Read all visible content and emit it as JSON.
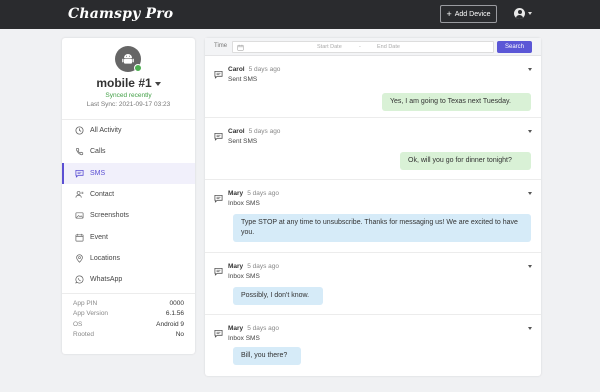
{
  "app": {
    "logo": "Chamspy Pro"
  },
  "topbar": {
    "add_device_label": "Add Device"
  },
  "device": {
    "name": "mobile #1",
    "sync_status": "Synced recently",
    "last_sync": "Last Sync: 2021-09-17 03:23"
  },
  "nav": {
    "items": [
      {
        "label": "All Activity",
        "icon": "clock-icon"
      },
      {
        "label": "Calls",
        "icon": "phone-icon"
      },
      {
        "label": "SMS",
        "icon": "message-icon",
        "active": true
      },
      {
        "label": "Contact",
        "icon": "contacts-icon"
      },
      {
        "label": "Screenshots",
        "icon": "image-icon"
      },
      {
        "label": "Event",
        "icon": "calendar-icon"
      },
      {
        "label": "Locations",
        "icon": "location-icon"
      },
      {
        "label": "WhatsApp",
        "icon": "whatsapp-icon"
      }
    ]
  },
  "info": {
    "rows": [
      {
        "key": "App PIN",
        "value": "0000"
      },
      {
        "key": "App Version",
        "value": "6.1.56"
      },
      {
        "key": "OS",
        "value": "Android 9"
      },
      {
        "key": "Rooted",
        "value": "No"
      }
    ]
  },
  "filter": {
    "time_label": "Time",
    "start_placeholder": "Start Date",
    "separator": "-",
    "end_placeholder": "End Date",
    "search_label": "Search"
  },
  "messages": [
    {
      "name": "Carol",
      "time": "5 days ago",
      "type": "Sent SMS",
      "text": "Yes, I am going to Texas next Tuesday.",
      "direction": "sent"
    },
    {
      "name": "Carol",
      "time": "5 days ago",
      "type": "Sent SMS",
      "text": "Ok, will you go for dinner tonight?",
      "direction": "sent"
    },
    {
      "name": "Mary",
      "time": "5 days ago",
      "type": "Inbox SMS",
      "text": "Type STOP at any time to unsubscribe. Thanks for messaging us! We are excited to have you.",
      "direction": "inbox"
    },
    {
      "name": "Mary",
      "time": "5 days ago",
      "type": "Inbox SMS",
      "text": "Possibly, I don't know.",
      "direction": "inbox"
    },
    {
      "name": "Mary",
      "time": "5 days ago",
      "type": "Inbox SMS",
      "text": "Bill, you there?",
      "direction": "inbox"
    }
  ],
  "colors": {
    "accent": "#5b57d6",
    "topbar": "#2a2b2e",
    "sent_bubble": "#d9f1d6",
    "inbox_bubble": "#d6ebf8",
    "online": "#4caf50"
  }
}
